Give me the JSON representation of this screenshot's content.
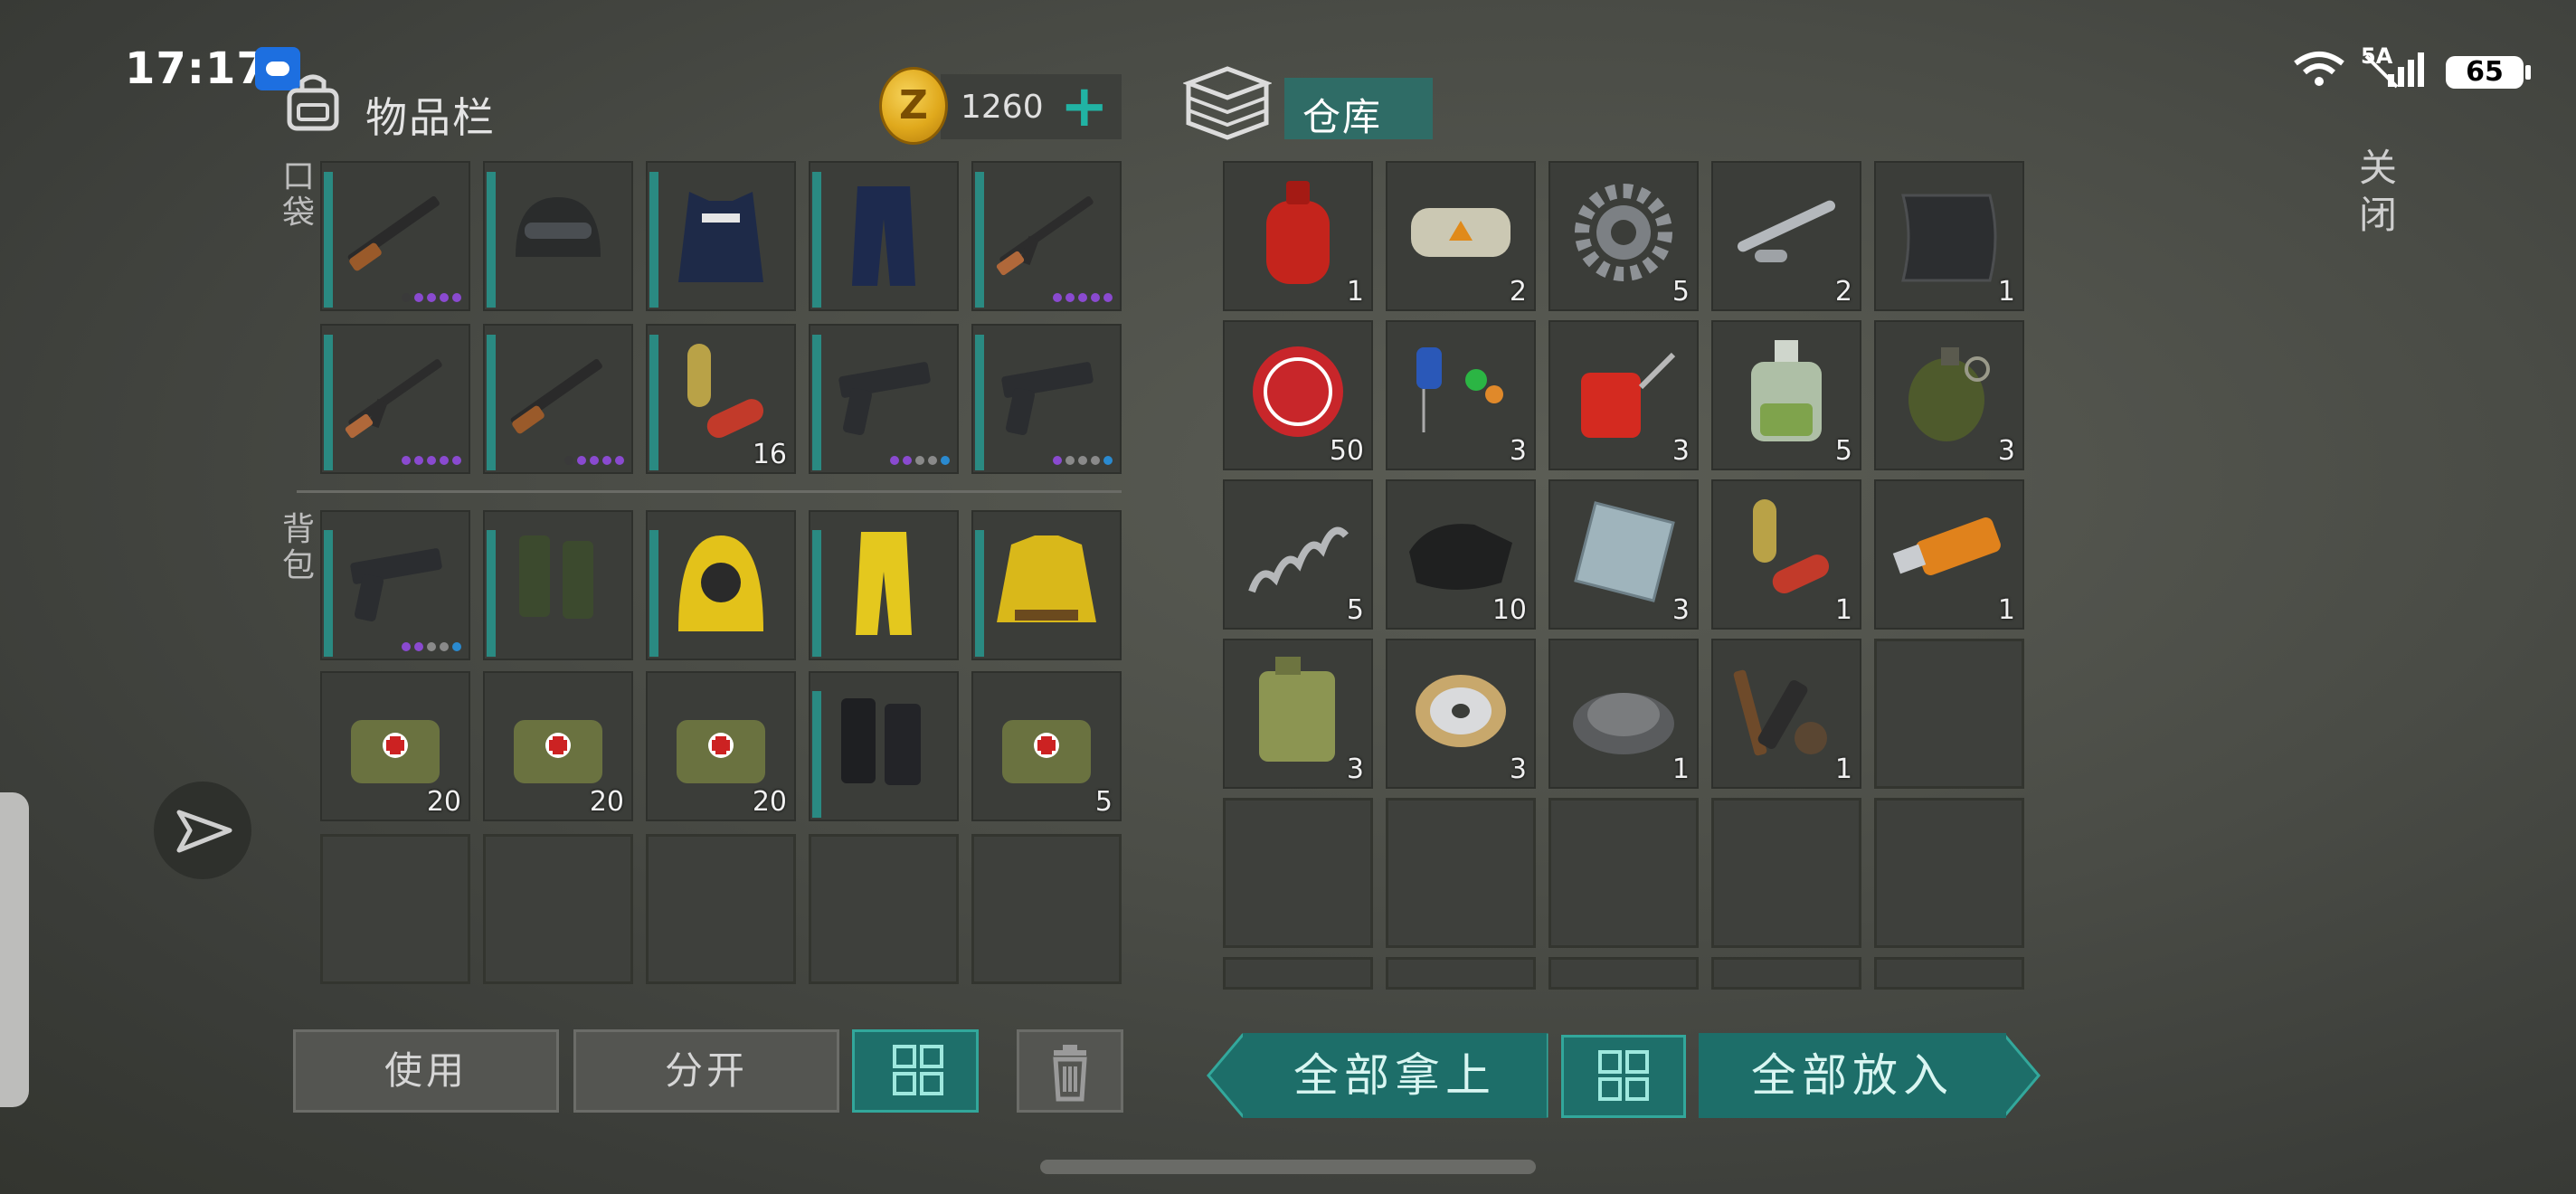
{
  "status": {
    "time": "17:17",
    "network": "5A",
    "battery": "65"
  },
  "inventory": {
    "title": "物品栏",
    "coins": "1260",
    "pockets_label": "口袋",
    "backpack_label": "背包",
    "pockets": [
      {
        "icon": "shotgun-icon",
        "dots": [
          "#3a3a3a",
          "#8a4ad0",
          "#8a4ad0",
          "#8a4ad0",
          "#8a4ad0"
        ]
      },
      {
        "icon": "helmet-icon"
      },
      {
        "icon": "police-vest-icon"
      },
      {
        "icon": "police-pants-icon"
      },
      {
        "icon": "ak-rifle-icon",
        "dots": [
          "#8a4ad0",
          "#8a4ad0",
          "#8a4ad0",
          "#8a4ad0",
          "#8a4ad0"
        ]
      },
      {
        "icon": "ak-rifle-icon",
        "dots": [
          "#8a4ad0",
          "#8a4ad0",
          "#8a4ad0",
          "#8a4ad0",
          "#8a4ad0"
        ]
      },
      {
        "icon": "shotgun-icon",
        "dots": [
          "#3a3a3a",
          "#8a4ad0",
          "#8a4ad0",
          "#8a4ad0",
          "#8a4ad0"
        ]
      },
      {
        "icon": "pill-icon",
        "count": "16"
      },
      {
        "icon": "pistol-icon",
        "dots": [
          "#8a4ad0",
          "#8a4ad0",
          "#8a8a8a",
          "#8a8a8a",
          "#2a8ad0"
        ]
      },
      {
        "icon": "pistol-icon",
        "dots": [
          "#8a4ad0",
          "#8a8a8a",
          "#8a8a8a",
          "#8a8a8a",
          "#2a8ad0"
        ]
      }
    ],
    "backpack": [
      {
        "icon": "pistol-icon",
        "dots": [
          "#8a4ad0",
          "#8a4ad0",
          "#8a8a8a",
          "#8a8a8a",
          "#2a8ad0"
        ]
      },
      {
        "icon": "rubber-boots-icon"
      },
      {
        "icon": "hazmat-hood-icon"
      },
      {
        "icon": "hazmat-pants-icon"
      },
      {
        "icon": "hazmat-jacket-icon"
      },
      {
        "icon": "medkit-bag-icon",
        "count": "20"
      },
      {
        "icon": "medkit-bag-icon",
        "count": "20"
      },
      {
        "icon": "medkit-bag-icon",
        "count": "20"
      },
      {
        "icon": "combat-boots-icon"
      },
      {
        "icon": "medkit-bag-icon",
        "count": "5"
      },
      {
        "icon": ""
      },
      {
        "icon": ""
      },
      {
        "icon": ""
      },
      {
        "icon": ""
      },
      {
        "icon": ""
      }
    ],
    "buttons": {
      "use": "使用",
      "split": "分开"
    }
  },
  "storage": {
    "title": "仓库",
    "close_label": "关闭",
    "items": [
      {
        "icon": "gas-cylinder-icon",
        "count": "1"
      },
      {
        "icon": "explosive-charge-icon",
        "count": "2"
      },
      {
        "icon": "gear-icon",
        "count": "5"
      },
      {
        "icon": "pipe-parts-icon",
        "count": "2"
      },
      {
        "icon": "carbon-sheet-icon",
        "count": "1"
      },
      {
        "icon": "bottle-cap-icon",
        "count": "50"
      },
      {
        "icon": "electronic-parts-icon",
        "count": "3"
      },
      {
        "icon": "oil-can-icon",
        "count": "3"
      },
      {
        "icon": "chemical-bottle-icon",
        "count": "5"
      },
      {
        "icon": "grenade-icon",
        "count": "3"
      },
      {
        "icon": "spring-icon",
        "count": "5"
      },
      {
        "icon": "cloth-icon",
        "count": "10"
      },
      {
        "icon": "metal-plate-icon",
        "count": "3"
      },
      {
        "icon": "pill-icon",
        "count": "1"
      },
      {
        "icon": "usb-drive-icon",
        "count": "1"
      },
      {
        "icon": "jerrycan-icon",
        "count": "3"
      },
      {
        "icon": "wire-spool-icon",
        "count": "3"
      },
      {
        "icon": "gravel-icon",
        "count": "1"
      },
      {
        "icon": "tool-parts-icon",
        "count": "1"
      },
      {
        "icon": ""
      },
      {
        "icon": ""
      },
      {
        "icon": ""
      },
      {
        "icon": ""
      },
      {
        "icon": ""
      },
      {
        "icon": ""
      },
      {
        "icon": ""
      },
      {
        "icon": ""
      },
      {
        "icon": ""
      },
      {
        "icon": ""
      },
      {
        "icon": ""
      }
    ],
    "buttons": {
      "take_all": "全部拿上",
      "put_all": "全部放入"
    }
  }
}
